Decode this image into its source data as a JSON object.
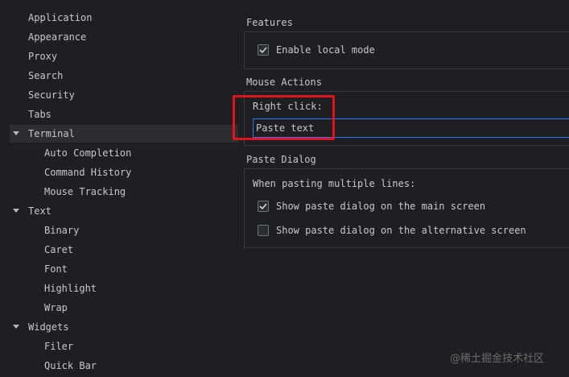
{
  "sidebar": {
    "items": [
      {
        "label": "Application",
        "level": 0,
        "expanded": null
      },
      {
        "label": "Appearance",
        "level": 0,
        "expanded": null
      },
      {
        "label": "Proxy",
        "level": 0,
        "expanded": null
      },
      {
        "label": "Search",
        "level": 0,
        "expanded": null
      },
      {
        "label": "Security",
        "level": 0,
        "expanded": null
      },
      {
        "label": "Tabs",
        "level": 0,
        "expanded": null
      },
      {
        "label": "Terminal",
        "level": 0,
        "expanded": true,
        "selected": true
      },
      {
        "label": "Auto Completion",
        "level": 1
      },
      {
        "label": "Command History",
        "level": 1
      },
      {
        "label": "Mouse Tracking",
        "level": 1
      },
      {
        "label": "Text",
        "level": 0,
        "expanded": true
      },
      {
        "label": "Binary",
        "level": 1
      },
      {
        "label": "Caret",
        "level": 1
      },
      {
        "label": "Font",
        "level": 1
      },
      {
        "label": "Highlight",
        "level": 1
      },
      {
        "label": "Wrap",
        "level": 1
      },
      {
        "label": "Widgets",
        "level": 0,
        "expanded": true
      },
      {
        "label": "Filer",
        "level": 1
      },
      {
        "label": "Quick Bar",
        "level": 1
      }
    ]
  },
  "features": {
    "title": "Features",
    "enable_local_mode": {
      "label": "Enable local mode",
      "checked": true
    }
  },
  "mouse_actions": {
    "title": "Mouse Actions",
    "right_click_label": "Right click:",
    "right_click_value": "Paste text"
  },
  "paste_dialog": {
    "title": "Paste Dialog",
    "description": "When pasting multiple lines:",
    "main_screen": {
      "label": "Show paste dialog on the main screen",
      "checked": true
    },
    "alt_screen": {
      "label": "Show paste dialog on the alternative screen",
      "checked": false
    }
  },
  "watermark": "@稀土掘金技术社区",
  "colors": {
    "background": "#1e1f22",
    "selection": "#2b2d30",
    "focus_border": "#3574f0",
    "annotation_red": "#e0141e"
  }
}
